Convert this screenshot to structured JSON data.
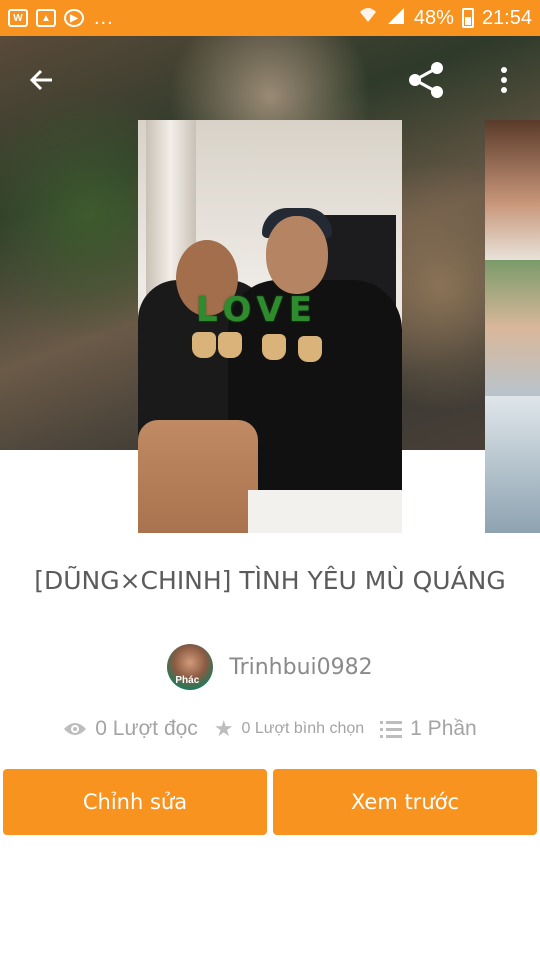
{
  "status_bar": {
    "notif_dots": "...",
    "battery": "48%",
    "time": "21:54"
  },
  "header": {
    "back_icon": "arrow-left-icon",
    "share_icon": "share-icon",
    "menu_icon": "more-vertical-icon"
  },
  "cover": {
    "overlay_text": "LOVE"
  },
  "story": {
    "title": "[DŨNG×CHINH] TÌNH YÊU MÙ QUÁNG",
    "author": "Trinhbui0982",
    "avatar_text": "Phác"
  },
  "stats": {
    "reads": "0 Lượt đọc",
    "votes": "0 Lượt bình chọn",
    "parts": "1 Phần"
  },
  "actions": {
    "edit_label": "Chỉnh sửa",
    "preview_label": "Xem trước"
  },
  "colors": {
    "accent": "#f7931e",
    "title_text": "#5b5b5b",
    "muted_text": "#a4a4a4"
  }
}
